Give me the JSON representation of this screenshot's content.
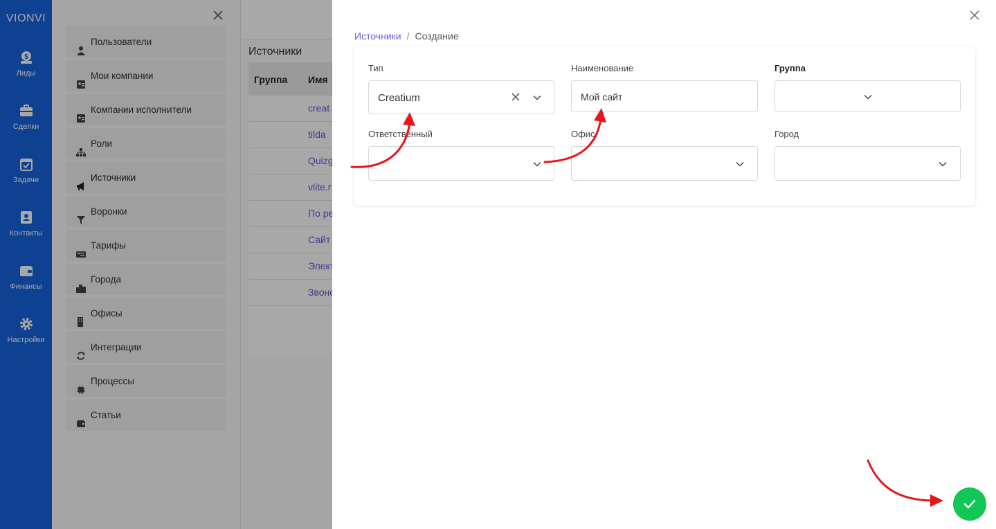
{
  "app": {
    "brand": "VIONVI"
  },
  "nav": {
    "items": [
      {
        "label": "Лиды",
        "icon": "money-bag-icon"
      },
      {
        "label": "Сделки",
        "icon": "briefcase-icon"
      },
      {
        "label": "Задачи",
        "icon": "calendar-check-icon"
      },
      {
        "label": "Контакты",
        "icon": "contact-book-icon"
      },
      {
        "label": "Финансы",
        "icon": "wallet-icon"
      },
      {
        "label": "Настройки",
        "icon": "gear-icon"
      }
    ]
  },
  "settings_menu": {
    "items": [
      {
        "label": "Пользователи",
        "icon": "user-icon"
      },
      {
        "label": "Мои компании",
        "icon": "id-card-icon"
      },
      {
        "label": "Компании исполнители",
        "icon": "id-card-icon"
      },
      {
        "label": "Роли",
        "icon": "sitemap-icon"
      },
      {
        "label": "Источники",
        "icon": "megaphone-icon",
        "active": true
      },
      {
        "label": "Воронки",
        "icon": "funnel-icon"
      },
      {
        "label": "Тарифы",
        "icon": "tariff-icon"
      },
      {
        "label": "Города",
        "icon": "city-icon"
      },
      {
        "label": "Офисы",
        "icon": "building-icon"
      },
      {
        "label": "Интеграции",
        "icon": "sync-icon"
      },
      {
        "label": "Процессы",
        "icon": "chip-icon"
      },
      {
        "label": "Статьи",
        "icon": "wallet-icon"
      }
    ]
  },
  "background_page": {
    "title": "Источники",
    "columns": [
      "Группа",
      "Имя"
    ],
    "rows": [
      "creat",
      "tilda",
      "Quizg",
      "vlite.r",
      "По ре",
      "Сайт",
      "Элект",
      "Звоно"
    ]
  },
  "drawer": {
    "breadcrumb": {
      "parent": "Источники",
      "separator": "/",
      "current": "Создание"
    },
    "fields": {
      "type": {
        "label": "Тип",
        "value": "Creatium"
      },
      "name": {
        "label": "Наименование",
        "value": "Мой сайт"
      },
      "group": {
        "label": "Группа",
        "value": ""
      },
      "responsible": {
        "label": "Ответственный",
        "value": ""
      },
      "office": {
        "label": "Офис",
        "value": ""
      },
      "city": {
        "label": "Город",
        "value": ""
      }
    }
  },
  "colors": {
    "nav": "#1763e0",
    "link": "#6a5be0",
    "submit": "#12c755",
    "annotation": "#e8141b"
  }
}
